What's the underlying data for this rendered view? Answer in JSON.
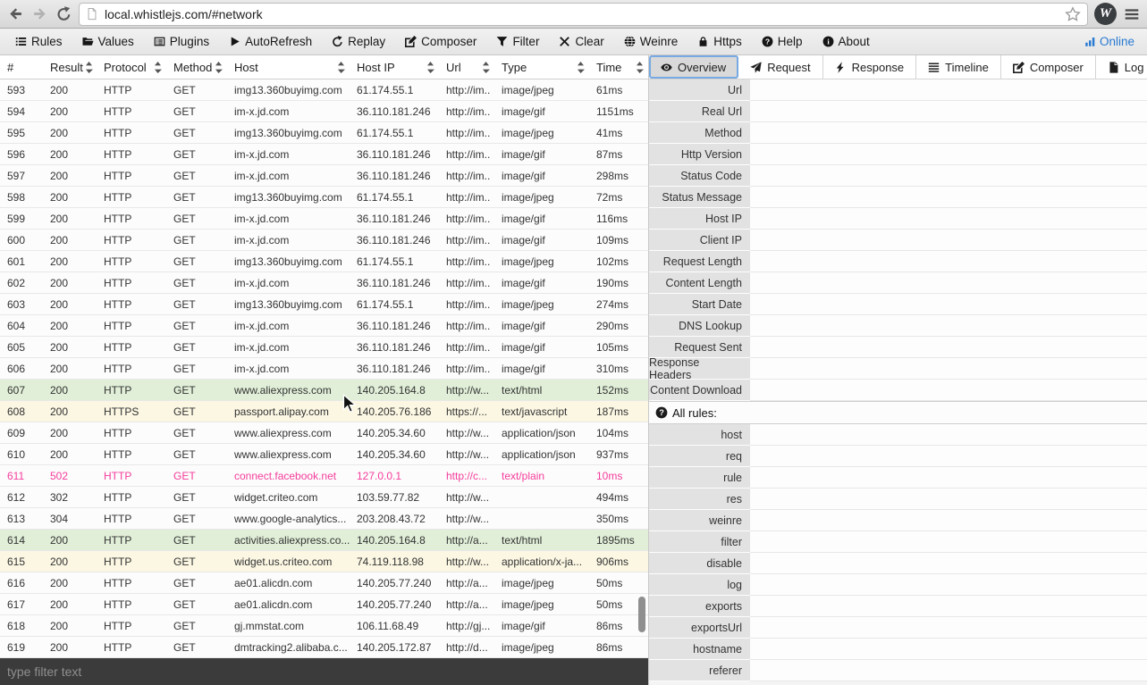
{
  "colors": {
    "accent_blue": "#2779d2",
    "selected_tab_outline": "#78a9e2",
    "row_green": "#e1efd8",
    "row_yellow": "#fbf7e3",
    "row_error_text": "#f53c9b",
    "filter_bar_bg": "#3b3b3b"
  },
  "browser": {
    "url": "local.whistlejs.com/#network",
    "logo_text": "W"
  },
  "toolbar": {
    "items": [
      {
        "label": "Rules",
        "icon": "list-icon"
      },
      {
        "label": "Values",
        "icon": "folder-open-icon"
      },
      {
        "label": "Plugins",
        "icon": "plugins-icon"
      },
      {
        "label": "AutoRefresh",
        "icon": "play-icon"
      },
      {
        "label": "Replay",
        "icon": "replay-icon"
      },
      {
        "label": "Composer",
        "icon": "compose-icon"
      },
      {
        "label": "Filter",
        "icon": "funnel-icon"
      },
      {
        "label": "Clear",
        "icon": "clear-icon"
      },
      {
        "label": "Weinre",
        "icon": "globe-icon"
      },
      {
        "label": "Https",
        "icon": "lock-icon"
      },
      {
        "label": "Help",
        "icon": "question-circle-icon"
      },
      {
        "label": "About",
        "icon": "info-circle-icon"
      }
    ],
    "status_label": "Online"
  },
  "table": {
    "columns": [
      {
        "label": "#",
        "sortable": false
      },
      {
        "label": "Result",
        "sortable": true
      },
      {
        "label": "Protocol",
        "sortable": true
      },
      {
        "label": "Method",
        "sortable": true
      },
      {
        "label": "Host",
        "sortable": true
      },
      {
        "label": "Host IP",
        "sortable": true
      },
      {
        "label": "Url",
        "sortable": true
      },
      {
        "label": "Type",
        "sortable": true
      },
      {
        "label": "Time",
        "sortable": true
      }
    ],
    "rows": [
      {
        "num": "593",
        "result": "200",
        "protocol": "HTTP",
        "method": "GET",
        "host": "img13.360buyimg.com",
        "host_ip": "61.174.55.1",
        "url": "http://im..",
        "type": "image/jpeg",
        "time": "61ms",
        "state": "normal"
      },
      {
        "num": "594",
        "result": "200",
        "protocol": "HTTP",
        "method": "GET",
        "host": "im-x.jd.com",
        "host_ip": "36.110.181.246",
        "url": "http://im..",
        "type": "image/gif",
        "time": "1151ms",
        "state": "normal"
      },
      {
        "num": "595",
        "result": "200",
        "protocol": "HTTP",
        "method": "GET",
        "host": "img13.360buyimg.com",
        "host_ip": "61.174.55.1",
        "url": "http://im..",
        "type": "image/jpeg",
        "time": "41ms",
        "state": "normal"
      },
      {
        "num": "596",
        "result": "200",
        "protocol": "HTTP",
        "method": "GET",
        "host": "im-x.jd.com",
        "host_ip": "36.110.181.246",
        "url": "http://im..",
        "type": "image/gif",
        "time": "87ms",
        "state": "normal"
      },
      {
        "num": "597",
        "result": "200",
        "protocol": "HTTP",
        "method": "GET",
        "host": "im-x.jd.com",
        "host_ip": "36.110.181.246",
        "url": "http://im..",
        "type": "image/gif",
        "time": "298ms",
        "state": "normal"
      },
      {
        "num": "598",
        "result": "200",
        "protocol": "HTTP",
        "method": "GET",
        "host": "img13.360buyimg.com",
        "host_ip": "61.174.55.1",
        "url": "http://im..",
        "type": "image/jpeg",
        "time": "72ms",
        "state": "normal"
      },
      {
        "num": "599",
        "result": "200",
        "protocol": "HTTP",
        "method": "GET",
        "host": "im-x.jd.com",
        "host_ip": "36.110.181.246",
        "url": "http://im..",
        "type": "image/gif",
        "time": "116ms",
        "state": "normal"
      },
      {
        "num": "600",
        "result": "200",
        "protocol": "HTTP",
        "method": "GET",
        "host": "im-x.jd.com",
        "host_ip": "36.110.181.246",
        "url": "http://im..",
        "type": "image/gif",
        "time": "109ms",
        "state": "normal"
      },
      {
        "num": "601",
        "result": "200",
        "protocol": "HTTP",
        "method": "GET",
        "host": "img13.360buyimg.com",
        "host_ip": "61.174.55.1",
        "url": "http://im..",
        "type": "image/jpeg",
        "time": "102ms",
        "state": "normal"
      },
      {
        "num": "602",
        "result": "200",
        "protocol": "HTTP",
        "method": "GET",
        "host": "im-x.jd.com",
        "host_ip": "36.110.181.246",
        "url": "http://im..",
        "type": "image/gif",
        "time": "190ms",
        "state": "normal"
      },
      {
        "num": "603",
        "result": "200",
        "protocol": "HTTP",
        "method": "GET",
        "host": "img13.360buyimg.com",
        "host_ip": "61.174.55.1",
        "url": "http://im..",
        "type": "image/jpeg",
        "time": "274ms",
        "state": "normal"
      },
      {
        "num": "604",
        "result": "200",
        "protocol": "HTTP",
        "method": "GET",
        "host": "im-x.jd.com",
        "host_ip": "36.110.181.246",
        "url": "http://im..",
        "type": "image/gif",
        "time": "290ms",
        "state": "normal"
      },
      {
        "num": "605",
        "result": "200",
        "protocol": "HTTP",
        "method": "GET",
        "host": "im-x.jd.com",
        "host_ip": "36.110.181.246",
        "url": "http://im..",
        "type": "image/gif",
        "time": "105ms",
        "state": "normal"
      },
      {
        "num": "606",
        "result": "200",
        "protocol": "HTTP",
        "method": "GET",
        "host": "im-x.jd.com",
        "host_ip": "36.110.181.246",
        "url": "http://im..",
        "type": "image/gif",
        "time": "310ms",
        "state": "normal"
      },
      {
        "num": "607",
        "result": "200",
        "protocol": "HTTP",
        "method": "GET",
        "host": "www.aliexpress.com",
        "host_ip": "140.205.164.8",
        "url": "http://w...",
        "type": "text/html",
        "time": "152ms",
        "state": "green"
      },
      {
        "num": "608",
        "result": "200",
        "protocol": "HTTPS",
        "method": "GET",
        "host": "passport.alipay.com",
        "host_ip": "140.205.76.186",
        "url": "https://...",
        "type": "text/javascript",
        "time": "187ms",
        "state": "yellow"
      },
      {
        "num": "609",
        "result": "200",
        "protocol": "HTTP",
        "method": "GET",
        "host": "www.aliexpress.com",
        "host_ip": "140.205.34.60",
        "url": "http://w...",
        "type": "application/json",
        "time": "104ms",
        "state": "normal"
      },
      {
        "num": "610",
        "result": "200",
        "protocol": "HTTP",
        "method": "GET",
        "host": "www.aliexpress.com",
        "host_ip": "140.205.34.60",
        "url": "http://w...",
        "type": "application/json",
        "time": "937ms",
        "state": "normal"
      },
      {
        "num": "611",
        "result": "502",
        "protocol": "HTTP",
        "method": "GET",
        "host": "connect.facebook.net",
        "host_ip": "127.0.0.1",
        "url": "http://c...",
        "type": "text/plain",
        "time": "10ms",
        "state": "error"
      },
      {
        "num": "612",
        "result": "302",
        "protocol": "HTTP",
        "method": "GET",
        "host": "widget.criteo.com",
        "host_ip": "103.59.77.82",
        "url": "http://w...",
        "type": "",
        "time": "494ms",
        "state": "normal"
      },
      {
        "num": "613",
        "result": "304",
        "protocol": "HTTP",
        "method": "GET",
        "host": "www.google-analytics...",
        "host_ip": "203.208.43.72",
        "url": "http://w...",
        "type": "",
        "time": "350ms",
        "state": "normal"
      },
      {
        "num": "614",
        "result": "200",
        "protocol": "HTTP",
        "method": "GET",
        "host": "activities.aliexpress.co...",
        "host_ip": "140.205.164.8",
        "url": "http://a...",
        "type": "text/html",
        "time": "1895ms",
        "state": "green"
      },
      {
        "num": "615",
        "result": "200",
        "protocol": "HTTP",
        "method": "GET",
        "host": "widget.us.criteo.com",
        "host_ip": "74.119.118.98",
        "url": "http://w...",
        "type": "application/x-ja...",
        "time": "906ms",
        "state": "yellow"
      },
      {
        "num": "616",
        "result": "200",
        "protocol": "HTTP",
        "method": "GET",
        "host": "ae01.alicdn.com",
        "host_ip": "140.205.77.240",
        "url": "http://a...",
        "type": "image/jpeg",
        "time": "50ms",
        "state": "normal"
      },
      {
        "num": "617",
        "result": "200",
        "protocol": "HTTP",
        "method": "GET",
        "host": "ae01.alicdn.com",
        "host_ip": "140.205.77.240",
        "url": "http://a...",
        "type": "image/jpeg",
        "time": "50ms",
        "state": "normal"
      },
      {
        "num": "618",
        "result": "200",
        "protocol": "HTTP",
        "method": "GET",
        "host": "gj.mmstat.com",
        "host_ip": "106.11.68.49",
        "url": "http://gj...",
        "type": "image/gif",
        "time": "86ms",
        "state": "normal"
      },
      {
        "num": "619",
        "result": "200",
        "protocol": "HTTP",
        "method": "GET",
        "host": "dmtracking2.alibaba.c...",
        "host_ip": "140.205.172.87",
        "url": "http://d...",
        "type": "image/jpeg",
        "time": "86ms",
        "state": "normal"
      }
    ]
  },
  "filter": {
    "placeholder": "type filter text"
  },
  "detail": {
    "tabs": [
      {
        "label": "Overview",
        "icon": "eye-icon",
        "active": true
      },
      {
        "label": "Request",
        "icon": "send-icon",
        "active": false
      },
      {
        "label": "Response",
        "icon": "bolt-icon",
        "active": false
      },
      {
        "label": "Timeline",
        "icon": "timeline-icon",
        "active": false
      },
      {
        "label": "Composer",
        "icon": "compose-icon",
        "active": false
      },
      {
        "label": "Log",
        "icon": "file-icon",
        "active": false
      }
    ],
    "overview_fields": [
      "Url",
      "Real Url",
      "Method",
      "Http Version",
      "Status Code",
      "Status Message",
      "Host IP",
      "Client IP",
      "Request Length",
      "Content Length",
      "Start Date",
      "DNS Lookup",
      "Request Sent",
      "Response Headers",
      "Content Download"
    ],
    "rules_header": "All rules:",
    "rules": [
      "host",
      "req",
      "rule",
      "res",
      "weinre",
      "filter",
      "disable",
      "log",
      "exports",
      "exportsUrl",
      "hostname",
      "referer"
    ]
  }
}
